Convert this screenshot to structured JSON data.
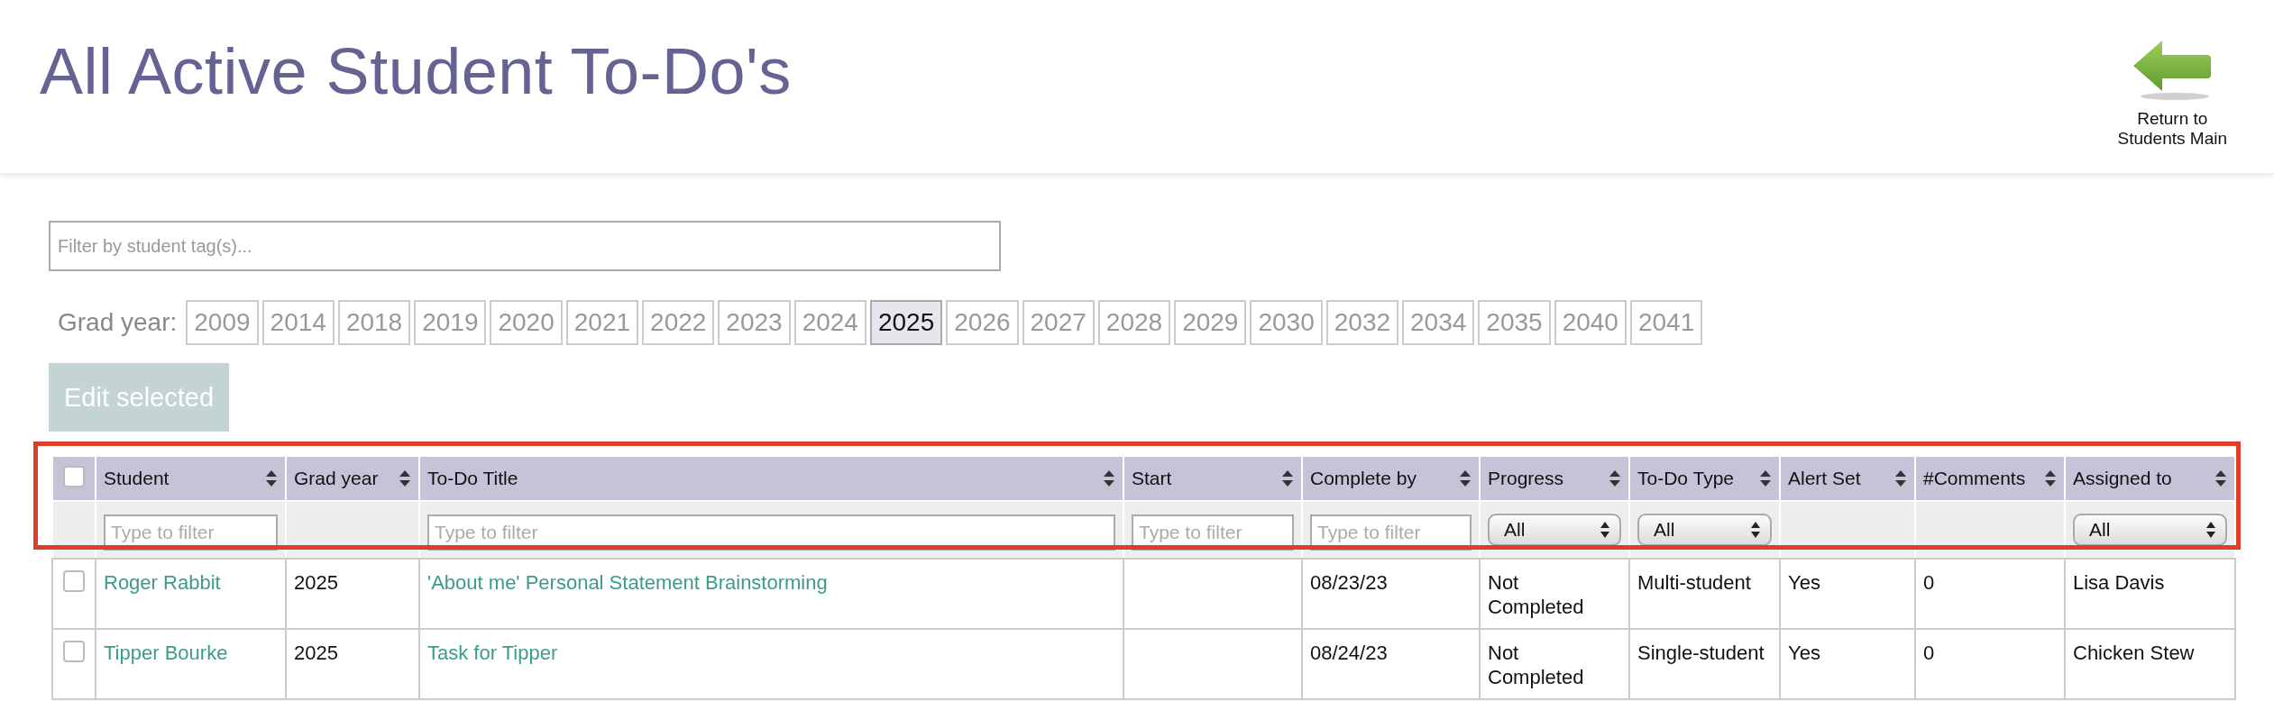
{
  "title": "All Active Student To-Do's",
  "return_link": {
    "lines": [
      "Return to",
      "Students Main"
    ]
  },
  "tag_filter": {
    "placeholder": "Filter by student tag(s)..."
  },
  "grad_year": {
    "label": "Grad year:",
    "years": [
      {
        "label": "2009",
        "selected": false
      },
      {
        "label": "2014",
        "selected": false
      },
      {
        "label": "2018",
        "selected": false
      },
      {
        "label": "2019",
        "selected": false
      },
      {
        "label": "2020",
        "selected": false
      },
      {
        "label": "2021",
        "selected": false
      },
      {
        "label": "2022",
        "selected": false
      },
      {
        "label": "2023",
        "selected": false
      },
      {
        "label": "2024",
        "selected": false
      },
      {
        "label": "2025",
        "selected": true
      },
      {
        "label": "2026",
        "selected": false
      },
      {
        "label": "2027",
        "selected": false
      },
      {
        "label": "2028",
        "selected": false
      },
      {
        "label": "2029",
        "selected": false
      },
      {
        "label": "2030",
        "selected": false
      },
      {
        "label": "2032",
        "selected": false
      },
      {
        "label": "2034",
        "selected": false
      },
      {
        "label": "2035",
        "selected": false
      },
      {
        "label": "2040",
        "selected": false
      },
      {
        "label": "2041",
        "selected": false
      }
    ]
  },
  "edit_button": {
    "label": "Edit selected",
    "disabled": true
  },
  "table": {
    "select_all": {
      "checked": false
    },
    "columns": [
      {
        "label": "Student",
        "filter": {
          "kind": "text",
          "placeholder": "Type to filter"
        }
      },
      {
        "label": "Grad year",
        "filter": {
          "kind": "none"
        }
      },
      {
        "label": "To-Do Title",
        "filter": {
          "kind": "text",
          "placeholder": "Type to filter"
        }
      },
      {
        "label": "Start",
        "filter": {
          "kind": "text",
          "placeholder": "Type to filter"
        }
      },
      {
        "label": "Complete by",
        "filter": {
          "kind": "text",
          "placeholder": "Type to filter"
        }
      },
      {
        "label": "Progress",
        "filter": {
          "kind": "select",
          "value": "All"
        }
      },
      {
        "label": "To-Do Type",
        "filter": {
          "kind": "select",
          "value": "All"
        }
      },
      {
        "label": "Alert Set",
        "filter": {
          "kind": "none"
        }
      },
      {
        "label": "#Comments",
        "filter": {
          "kind": "none"
        }
      },
      {
        "label": "Assigned to",
        "filter": {
          "kind": "select",
          "value": "All"
        }
      }
    ],
    "rows": [
      {
        "checked": false,
        "cells": [
          {
            "kind": "link",
            "text": "Roger Rabbit"
          },
          {
            "kind": "plain",
            "text": "2025"
          },
          {
            "kind": "link",
            "text": "'About me' Personal Statement Brainstorming"
          },
          null,
          {
            "kind": "plain",
            "text": "08/23/23"
          },
          {
            "kind": "plain",
            "text": "Not Completed"
          },
          {
            "kind": "plain",
            "text": "Multi-student"
          },
          {
            "kind": "plain",
            "text": "Yes"
          },
          {
            "kind": "plain",
            "text": "0"
          },
          {
            "kind": "plain",
            "text": "Lisa Davis"
          }
        ]
      },
      {
        "checked": false,
        "cells": [
          {
            "kind": "link",
            "text": "Tipper Bourke"
          },
          {
            "kind": "plain",
            "text": "2025"
          },
          {
            "kind": "link",
            "text": "Task for Tipper"
          },
          null,
          {
            "kind": "plain",
            "text": "08/24/23"
          },
          {
            "kind": "plain",
            "text": "Not Completed"
          },
          {
            "kind": "plain",
            "text": "Single-student"
          },
          {
            "kind": "plain",
            "text": "Yes"
          },
          {
            "kind": "plain",
            "text": "0"
          },
          {
            "kind": "plain",
            "text": "Chicken Stew"
          }
        ]
      }
    ]
  }
}
